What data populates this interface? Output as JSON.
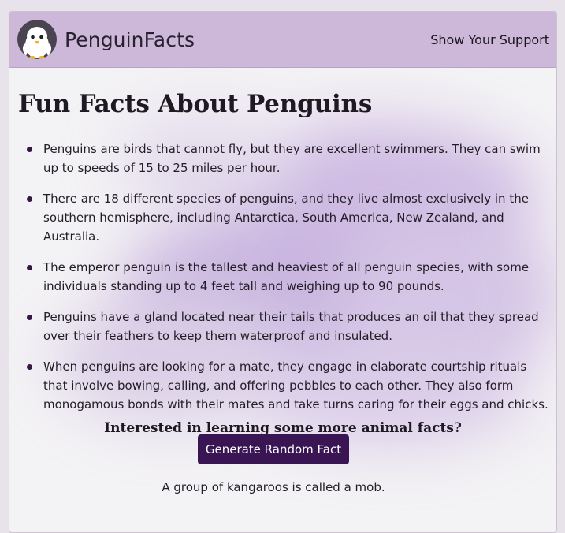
{
  "header": {
    "brand": "PenguinFacts",
    "logo_icon": "penguin-icon",
    "support_link": "Show Your Support"
  },
  "main": {
    "title": "Fun Facts About Penguins",
    "facts": [
      "Penguins are birds that cannot fly, but they are excellent swimmers. They can swim up to speeds of 15 to 25 miles per hour.",
      "There are 18 different species of penguins, and they live almost exclusively in the southern hemisphere, including Antarctica, South America, New Zealand, and Australia.",
      "The emperor penguin is the tallest and heaviest of all penguin species, with some individuals standing up to 4 feet tall and weighing up to 90 pounds.",
      "Penguins have a gland located near their tails that produces an oil that they spread over their feathers to keep them waterproof and insulated.",
      "When penguins are looking for a mate, they engage in elaborate courtship rituals that involve bowing, calling, and offering pebbles to each other. They also form monogamous bonds with their mates and take turns caring for their eggs and chicks."
    ],
    "cta_question": "Interested in learning some more animal facts?",
    "generate_button": "Generate Random Fact",
    "random_fact": "A group of kangaroos is called a mob."
  },
  "colors": {
    "header_bg": "#cdb8d9",
    "accent": "#3a1553",
    "bullet": "#351741"
  }
}
